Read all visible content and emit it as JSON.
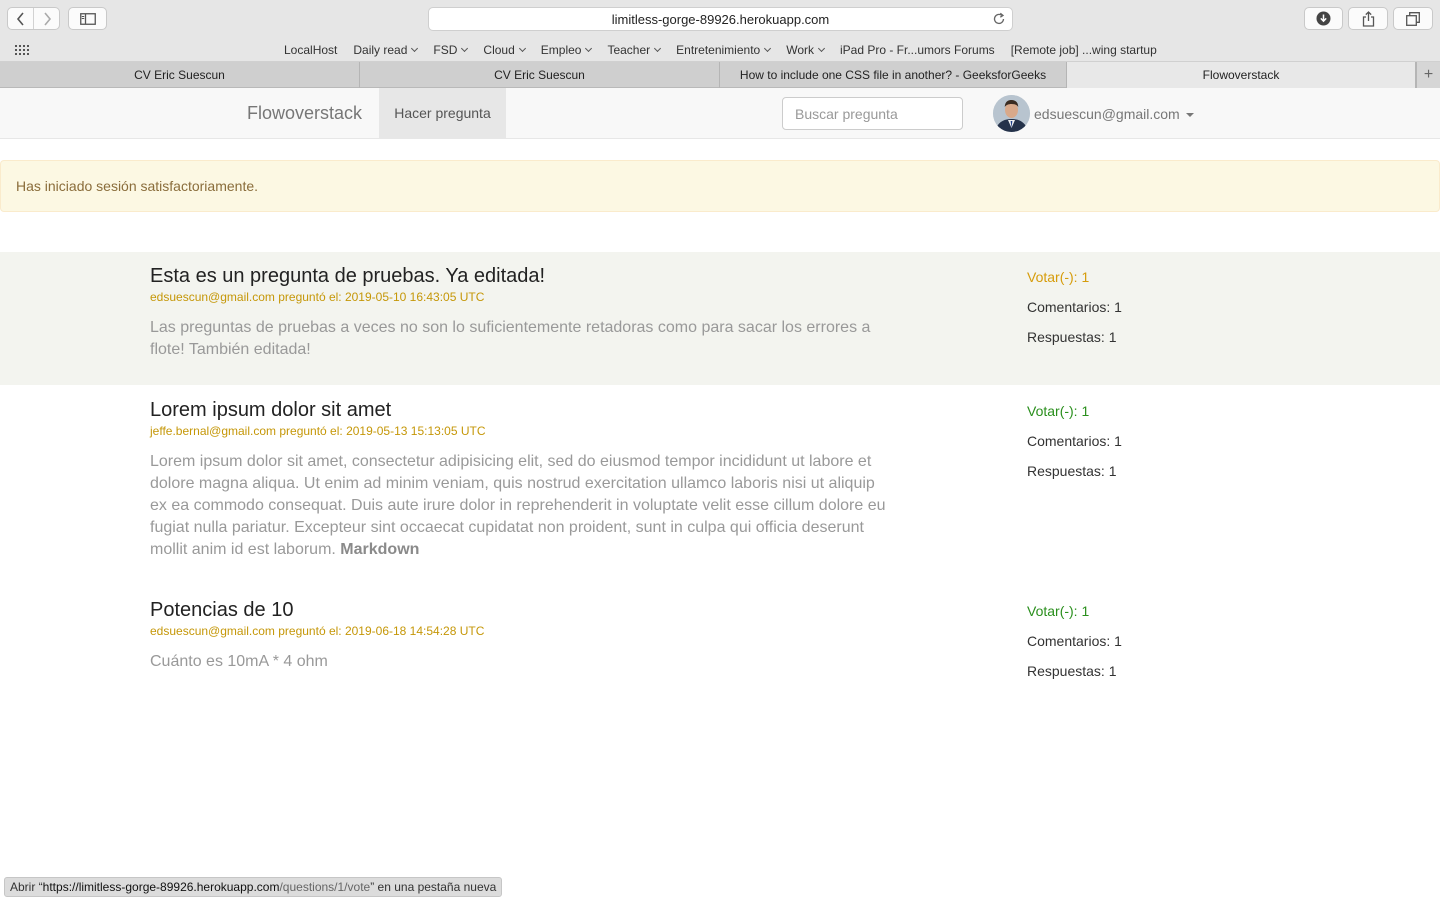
{
  "browser": {
    "url": "limitless-gorge-89926.herokuapp.com",
    "favorites": [
      {
        "label": "LocalHost",
        "menu": false
      },
      {
        "label": "Daily read",
        "menu": true
      },
      {
        "label": "FSD",
        "menu": true
      },
      {
        "label": "Cloud",
        "menu": true
      },
      {
        "label": "Empleo",
        "menu": true
      },
      {
        "label": "Teacher",
        "menu": true
      },
      {
        "label": "Entretenimiento",
        "menu": true
      },
      {
        "label": "Work",
        "menu": true
      },
      {
        "label": "iPad Pro - Fr...umors Forums",
        "menu": false
      },
      {
        "label": "[Remote job] ...wing startup",
        "menu": false
      }
    ],
    "tabs": [
      {
        "label": "CV Eric Suescun",
        "active": false
      },
      {
        "label": "CV Eric Suescun",
        "active": false
      },
      {
        "label": "How to include one CSS file in another? - GeeksforGeeks",
        "active": false
      },
      {
        "label": "Flowoverstack",
        "active": true
      }
    ],
    "tab_add": "+",
    "status": {
      "prefix": "Abrir “",
      "host": "https://limitless-gorge-89926.herokuapp.com",
      "path": "/questions/1/vote",
      "suffix": "” en una pestaña nueva"
    }
  },
  "navbar": {
    "brand": "Flowoverstack",
    "ask": "Hacer pregunta",
    "search_placeholder": "Buscar pregunta",
    "user_email": "edsuescun@gmail.com"
  },
  "alert": "Has iniciado sesión satisfactoriamente.",
  "questions": [
    {
      "title": "Esta es un pregunta de pruebas. Ya editada!",
      "meta": "edsuescun@gmail.com preguntó el: 2019-05-10 16:43:05 UTC",
      "body": "Las preguntas de pruebas a veces no son lo suficientemente retadoras como para sacar los errores a flote! También editada!",
      "body_strong": "",
      "vote": "Votar(-): 1",
      "comments": "Comentarios: 1",
      "answers": "Respuestas: 1"
    },
    {
      "title": "Lorem ipsum dolor sit amet",
      "meta": "jeffe.bernal@gmail.com preguntó el: 2019-05-13 15:13:05 UTC",
      "body": "Lorem ipsum dolor sit amet, consectetur adipisicing elit, sed do eiusmod tempor incididunt ut labore et dolore magna aliqua. Ut enim ad minim veniam, quis nostrud exercitation ullamco laboris nisi ut aliquip ex ea commodo consequat. Duis aute irure dolor in reprehenderit in voluptate velit esse cillum dolore eu fugiat nulla pariatur. Excepteur sint occaecat cupidatat non proident, sunt in culpa qui officia deserunt mollit anim id est laborum.",
      "body_strong": "Markdown",
      "vote": "Votar(-): 1",
      "comments": "Comentarios: 1",
      "answers": "Respuestas: 1"
    },
    {
      "title": "Potencias de 10",
      "meta": "edsuescun@gmail.com preguntó el: 2019-06-18 14:54:28 UTC",
      "body": "Cuánto es 10mA * 4 ohm",
      "body_strong": "",
      "vote": "Votar(-): 1",
      "comments": "Comentarios: 1",
      "answers": "Respuestas: 1"
    }
  ],
  "colors": {
    "alert_bg": "#fcf8e3",
    "alert_text": "#8a6d3b",
    "meta": "#c59708",
    "vote_green": "#2a8f1d",
    "vote_amber": "#d69c0b",
    "highlight_row": "#f3f4ef"
  },
  "icons": [
    "back-icon",
    "forward-icon",
    "sidebar-icon",
    "reload-icon",
    "download-icon",
    "share-icon",
    "tabs-icon",
    "grid-icon",
    "avatar"
  ]
}
